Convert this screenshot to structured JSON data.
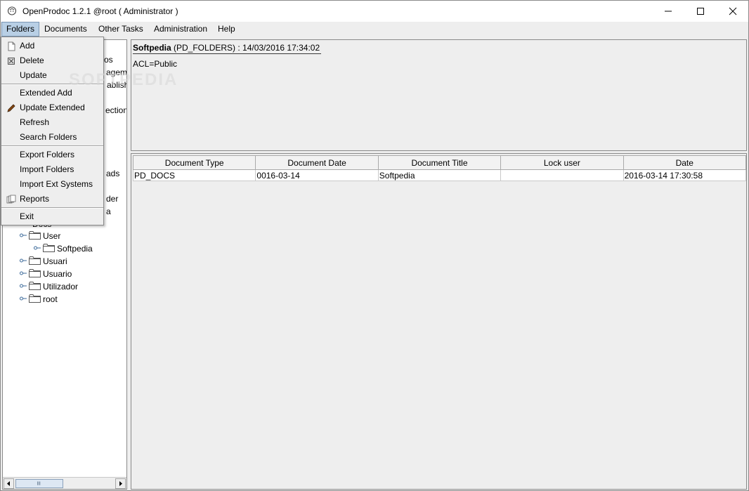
{
  "window": {
    "title": "OpenProdoc 1.2.1 @root ( Administrator )"
  },
  "menubar": {
    "items": [
      "Folders",
      "Documents",
      "Other Tasks",
      "Administration",
      "Help"
    ]
  },
  "folders_menu": {
    "items": [
      "Add",
      "Delete",
      "Update",
      "Extended Add",
      "Update Extended",
      "Refresh",
      "Search Folders",
      "Export Folders",
      "Import Folders",
      "Import Ext Systems",
      "Reports",
      "Exit"
    ]
  },
  "tree": {
    "partial_labels": [
      "os",
      "agem",
      "ablish",
      "ection",
      "ads",
      "der",
      "a",
      "Docs"
    ],
    "nodes": [
      {
        "label": "User"
      },
      {
        "label": "Softpedia"
      },
      {
        "label": "Usuari"
      },
      {
        "label": "Usuario"
      },
      {
        "label": "Utilizador"
      },
      {
        "label": "root"
      }
    ]
  },
  "info": {
    "folder_name": "Softpedia",
    "folder_meta": "(PD_FOLDERS) : 14/03/2016 17:34:02",
    "acl": "ACL=Public"
  },
  "table": {
    "columns": [
      "Document Type",
      "Document Date",
      "Document Title",
      "Lock user",
      "Date"
    ],
    "rows": [
      [
        "PD_DOCS",
        "0016-03-14",
        "Softpedia",
        "",
        "2016-03-14 17:30:58"
      ]
    ]
  },
  "watermark": "SOFTPEDIA",
  "colors": {
    "menu_active_bg": "#b8cfe5",
    "panel_bg": "#eeeeee",
    "folder_icon_stroke": "#555555"
  }
}
